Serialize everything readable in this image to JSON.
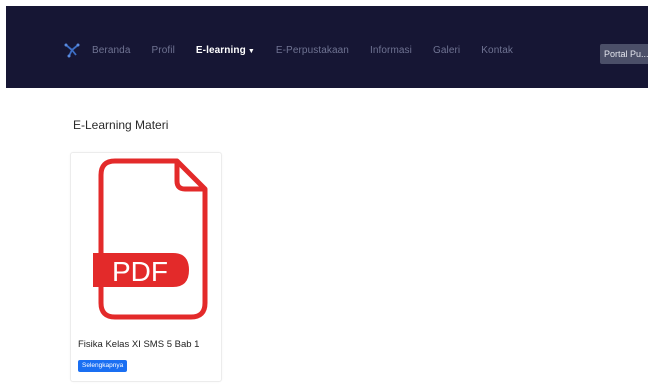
{
  "navbar": {
    "logo_icon": "network-logo-icon",
    "links": [
      {
        "label": "Beranda",
        "active": false
      },
      {
        "label": "Profil",
        "active": false
      },
      {
        "label": "E-learning",
        "active": true
      },
      {
        "label": "E-Perpustakaan",
        "active": false
      },
      {
        "label": "Informasi",
        "active": false
      },
      {
        "label": "Galeri",
        "active": false
      },
      {
        "label": "Kontak",
        "active": false
      }
    ],
    "login_label": "Portal Pu..."
  },
  "main": {
    "title": "E-Learning Materi",
    "materials": [
      {
        "title": "Fisika Kelas XI SMS 5 Bab 1",
        "icon": "pdf-file-icon",
        "icon_label": "PDF",
        "button_label": "Selengkapnya"
      }
    ]
  },
  "colors": {
    "navbar_bg": "#161634",
    "pdf_red": "#e32a2a",
    "button_blue": "#1a6ff2"
  }
}
